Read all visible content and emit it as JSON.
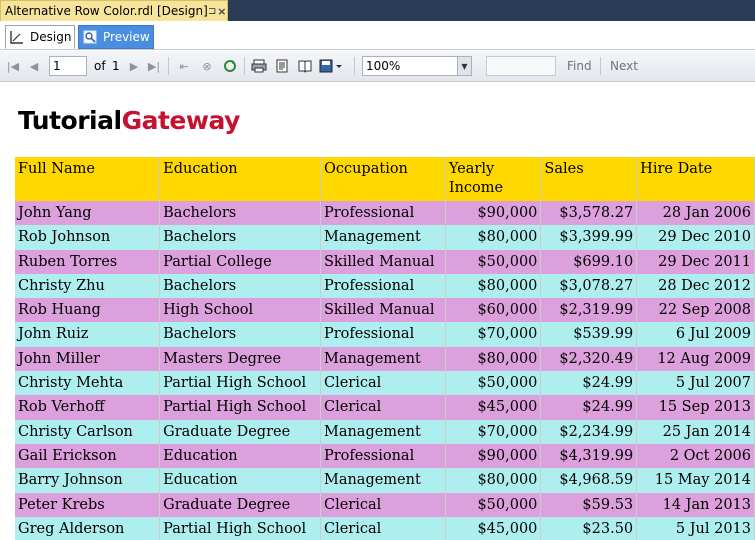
{
  "document_tab": {
    "title": "Alternative Row Color.rdl [Design]",
    "pin": "⊐",
    "close": "×"
  },
  "mode_tabs": {
    "design": "Design",
    "preview": "Preview"
  },
  "toolbar": {
    "page_value": "1",
    "of_label": "of",
    "total_pages": "1",
    "zoom_value": "100%",
    "find_label": "Find",
    "next_label": "Next"
  },
  "logo": {
    "part1": "Tutorial",
    "part2": "Gateway"
  },
  "colors": {
    "header": "#ffd800",
    "odd_row": "#dca0dc",
    "even_row": "#afeeee",
    "logo_accent": "#c41230"
  },
  "table": {
    "headers": [
      "Full Name",
      "Education",
      "Occupation",
      "Yearly Income",
      "Sales",
      "Hire Date"
    ],
    "rows": [
      [
        "John Yang",
        "Bachelors",
        "Professional",
        "$90,000",
        "$3,578.27",
        "28 Jan 2006"
      ],
      [
        "Rob Johnson",
        "Bachelors",
        "Management",
        "$80,000",
        "$3,399.99",
        "29 Dec 2010"
      ],
      [
        "Ruben Torres",
        "Partial College",
        "Skilled Manual",
        "$50,000",
        "$699.10",
        "29 Dec 2011"
      ],
      [
        "Christy Zhu",
        "Bachelors",
        "Professional",
        "$80,000",
        "$3,078.27",
        "28 Dec 2012"
      ],
      [
        "Rob Huang",
        "High School",
        "Skilled Manual",
        "$60,000",
        "$2,319.99",
        "22 Sep 2008"
      ],
      [
        "John Ruiz",
        "Bachelors",
        "Professional",
        "$70,000",
        "$539.99",
        "6 Jul 2009"
      ],
      [
        "John Miller",
        "Masters Degree",
        "Management",
        "$80,000",
        "$2,320.49",
        "12 Aug 2009"
      ],
      [
        "Christy Mehta",
        "Partial High School",
        "Clerical",
        "$50,000",
        "$24.99",
        "5 Jul 2007"
      ],
      [
        "Rob Verhoff",
        "Partial High School",
        "Clerical",
        "$45,000",
        "$24.99",
        "15 Sep 2013"
      ],
      [
        "Christy Carlson",
        "Graduate Degree",
        "Management",
        "$70,000",
        "$2,234.99",
        "25 Jan 2014"
      ],
      [
        "Gail Erickson",
        "Education",
        "Professional",
        "$90,000",
        "$4,319.99",
        "2 Oct 2006"
      ],
      [
        "Barry Johnson",
        "Education",
        "Management",
        "$80,000",
        "$4,968.59",
        "15 May 2014"
      ],
      [
        "Peter Krebs",
        "Graduate Degree",
        "Clerical",
        "$50,000",
        "$59.53",
        "14 Jan 2013"
      ],
      [
        "Greg Alderson",
        "Partial High School",
        "Clerical",
        "$45,000",
        "$23.50",
        "5 Jul 2013"
      ]
    ]
  }
}
